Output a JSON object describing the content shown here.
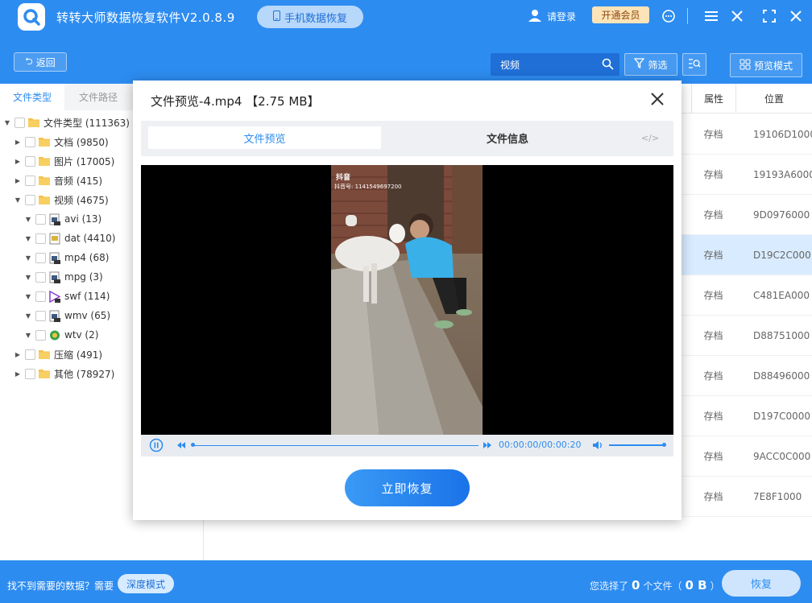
{
  "app": {
    "title": "转转大师数据恢复软件V2.0.8.9",
    "phone_recovery": "手机数据恢复",
    "login": "请登录",
    "vip": "开通会员"
  },
  "toolbar": {
    "back": "返回",
    "search_value": "视频",
    "filter": "筛选",
    "preview_mode": "预览模式"
  },
  "sidebar": {
    "tabs": [
      "文件类型",
      "文件路径"
    ],
    "tree": [
      {
        "label": "文件类型 (111363)",
        "level": 0,
        "arrow": "▼",
        "icon": "folder"
      },
      {
        "label": "文档 (9850)",
        "level": 1,
        "arrow": "▶",
        "icon": "folder"
      },
      {
        "label": "图片 (17005)",
        "level": 1,
        "arrow": "▶",
        "icon": "folder"
      },
      {
        "label": "音频 (415)",
        "level": 1,
        "arrow": "▶",
        "icon": "folder"
      },
      {
        "label": "视频 (4675)",
        "level": 1,
        "arrow": "▼",
        "icon": "folder"
      },
      {
        "label": "avi (13)",
        "level": 2,
        "arrow": "▼",
        "icon": "video-file"
      },
      {
        "label": "dat (4410)",
        "level": 2,
        "arrow": "▼",
        "icon": "dat-file"
      },
      {
        "label": "mp4 (68)",
        "level": 2,
        "arrow": "▼",
        "icon": "video-file"
      },
      {
        "label": "mpg (3)",
        "level": 2,
        "arrow": "▼",
        "icon": "video-file"
      },
      {
        "label": "swf (114)",
        "level": 2,
        "arrow": "▼",
        "icon": "swf-file"
      },
      {
        "label": "wmv (65)",
        "level": 2,
        "arrow": "▼",
        "icon": "video-file"
      },
      {
        "label": "wtv (2)",
        "level": 2,
        "arrow": "▼",
        "icon": "wtv-file"
      },
      {
        "label": "压缩 (491)",
        "level": 1,
        "arrow": "▶",
        "icon": "folder"
      },
      {
        "label": "其他 (78927)",
        "level": 1,
        "arrow": "▶",
        "icon": "folder"
      }
    ]
  },
  "table": {
    "headers": {
      "attr": "属性",
      "pos": "位置"
    },
    "rows": [
      {
        "attr": "存档",
        "pos": "19106D1000"
      },
      {
        "attr": "存档",
        "pos": "19193A6000"
      },
      {
        "attr": "存档",
        "pos": "9D0976000"
      },
      {
        "attr": "存档",
        "pos": "D19C2C000",
        "selected": true
      },
      {
        "attr": "存档",
        "pos": "C481EA000"
      },
      {
        "attr": "存档",
        "pos": "D88751000"
      },
      {
        "attr": "存档",
        "pos": "D88496000"
      },
      {
        "attr": "存档",
        "pos": "D197C0000"
      },
      {
        "attr": "存档",
        "pos": "9ACC0C000"
      },
      {
        "attr": "存档",
        "pos": "7E8F1000"
      }
    ]
  },
  "bottom": {
    "hint": "找不到需要的数据？需要",
    "deep_mode": "深度模式",
    "selected_prefix": "您选择了",
    "selected_count": "0",
    "selected_unit": "个文件（",
    "selected_size": "0 B",
    "selected_suffix": "）",
    "recover": "恢复"
  },
  "modal": {
    "title": "文件预览-4.mp4 【2.75 MB】",
    "tab_preview": "文件预览",
    "tab_info": "文件信息",
    "tab_code": "</>",
    "time": "00:00:00/00:00:20",
    "progress": 0.0,
    "volume": 1.0,
    "watermark": "抖音",
    "watermark_id": "抖音号: 1141549697200",
    "restore": "立即恢复"
  },
  "colors": {
    "accent": "#2d8cf0",
    "selected_row": "#d9ecff"
  }
}
